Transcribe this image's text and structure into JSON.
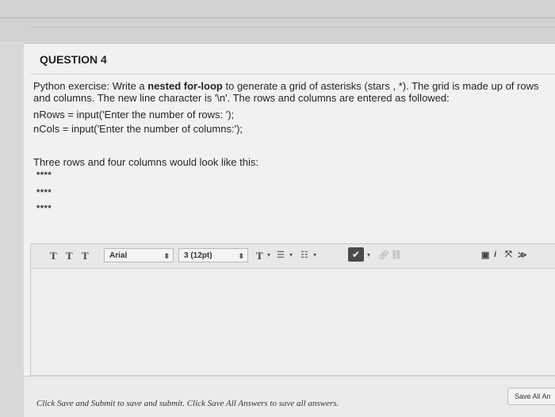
{
  "question": {
    "title": "QUESTION 4",
    "intro_1": "Python exercise: Write a ",
    "intro_bold": "nested for-loop",
    "intro_2": " to generate a grid of asterisks (stars , *). The grid is made up of rows and columns. The new line character is '\\n'. The rows and columns are entered as followed:",
    "code_line_1": "nRows = input('Enter the number of rows: ');",
    "code_line_2": "nCols = input('Enter the number of columns:');",
    "example_text": "Three rows and four columns  would look like this:",
    "star_rows": [
      "****",
      "****",
      "****"
    ]
  },
  "toolbar": {
    "t1": "T",
    "t2": "T",
    "t3": "T",
    "font_family": "Arial",
    "font_size": "3 (12pt)",
    "text_color": "T"
  },
  "footer": {
    "instruction": "Click Save and Submit to save and submit. Click Save All Answers to save all answers.",
    "save_all_label": "Save All An"
  }
}
